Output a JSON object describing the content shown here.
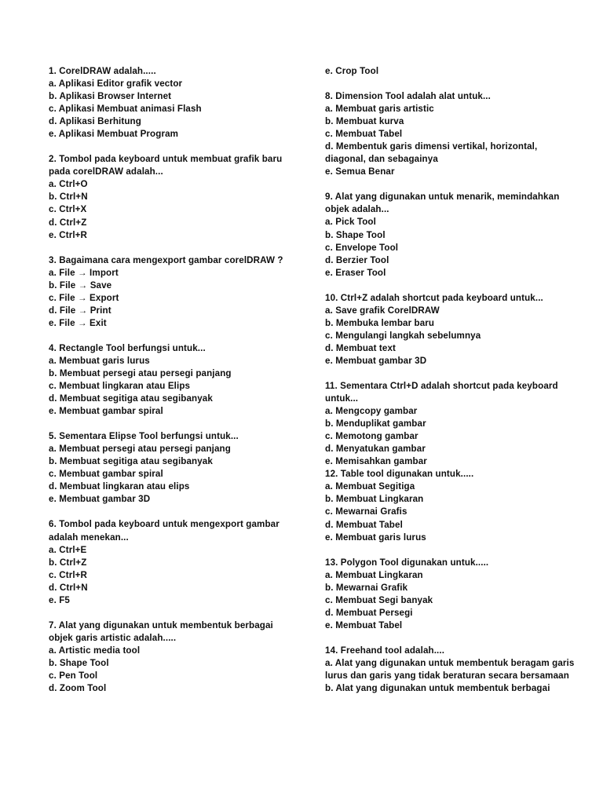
{
  "document": {
    "title": "Soal Pilihan Ganda CorelDRAW",
    "background_color": "#ffffff",
    "text_color": "#0f0f0f"
  },
  "columns": [
    {
      "name": "left-column",
      "blocks": [
        {
          "id": "q1",
          "tight": false,
          "lines": [
            "1. CorelDRAW adalah.....",
            "a. Aplikasi Editor grafik vector",
            "b. Aplikasi Browser Internet",
            "c. Aplikasi Membuat animasi Flash",
            "d. Aplikasi Berhitung",
            "e. Aplikasi Membuat Program"
          ]
        },
        {
          "id": "q2",
          "tight": false,
          "lines": [
            "2. Tombol pada keyboard untuk membuat grafik baru pada corelDRAW adalah...",
            "a. Ctrl+O",
            "b. Ctrl+N",
            "c. Ctrl+X",
            "d. Ctrl+Z",
            "e. Ctrl+R"
          ]
        },
        {
          "id": "q3",
          "tight": false,
          "lines": [
            "3. Bagaimana cara mengexport gambar corelDRAW ?",
            "a. File → Import",
            "b. File → Save",
            "c. File → Export",
            "d. File → Print",
            "e. File → Exit"
          ]
        },
        {
          "id": "q4",
          "tight": false,
          "lines": [
            "4. Rectangle Tool berfungsi untuk...",
            "a. Membuat garis lurus",
            "b. Membuat persegi atau persegi panjang",
            "c. Membuat lingkaran atau Elips",
            "d. Membuat segitiga atau segibanyak",
            "e. Membuat gambar spiral"
          ]
        },
        {
          "id": "q5",
          "tight": false,
          "lines": [
            "5. Sementara Elipse Tool berfungsi untuk...",
            "a. Membuat persegi atau persegi panjang",
            "b. Membuat segitiga atau segibanyak",
            "c. Membuat gambar spiral",
            "d. Membuat lingkaran atau elips",
            "e. Membuat gambar 3D"
          ]
        },
        {
          "id": "q6",
          "tight": false,
          "lines": [
            "6. Tombol pada keyboard untuk mengexport gambar adalah menekan...",
            "a. Ctrl+E",
            "b. Ctrl+Z",
            "c. Ctrl+R",
            "d. Ctrl+N",
            "e. F5"
          ]
        },
        {
          "id": "q7",
          "tight": false,
          "lines": [
            "7. Alat yang digunakan untuk membentuk berbagai objek garis artistic adalah.....",
            "a. Artistic media tool",
            "b. Shape Tool",
            "c. Pen Tool",
            "d. Zoom Tool"
          ]
        }
      ]
    },
    {
      "name": "right-column",
      "blocks": [
        {
          "id": "q7-continued",
          "tight": false,
          "lines": [
            "e. Crop Tool"
          ]
        },
        {
          "id": "q8",
          "tight": false,
          "lines": [
            "8. Dimension Tool adalah alat untuk...",
            "a. Membuat garis artistic",
            "b. Membuat kurva",
            "c. Membuat Tabel",
            "d. Membentuk garis dimensi vertikal, horizontal, diagonal, dan sebagainya",
            "e. Semua Benar"
          ]
        },
        {
          "id": "q9",
          "tight": false,
          "lines": [
            "9. Alat yang digunakan untuk menarik, memindahkan objek adalah...",
            "a. Pick Tool",
            "b. Shape Tool",
            "c. Envelope Tool",
            "d. Berzier Tool",
            "e. Eraser Tool"
          ]
        },
        {
          "id": "q10",
          "tight": false,
          "lines": [
            "10. Ctrl+Z adalah shortcut pada keyboard untuk...",
            "a. Save grafik CorelDRAW",
            "b. Membuka lembar baru",
            "c. Mengulangi langkah sebelumnya",
            "d. Membuat text",
            "e. Membuat gambar 3D"
          ]
        },
        {
          "id": "q11",
          "tight": true,
          "lines": [
            "11. Sementara Ctrl+D adalah shortcut pada keyboard untuk...",
            "a. Mengcopy gambar",
            "b. Menduplikat gambar",
            "c. Memotong gambar",
            "d. Menyatukan gambar",
            "e. Memisahkan gambar"
          ]
        },
        {
          "id": "q12",
          "tight": false,
          "lines": [
            "12. Table tool digunakan untuk.....",
            "a. Membuat Segitiga",
            "b. Membuat Lingkaran",
            "c. Mewarnai Grafis",
            "d. Membuat Tabel",
            "e. Membuat garis lurus"
          ]
        },
        {
          "id": "q13",
          "tight": false,
          "lines": [
            "13. Polygon Tool digunakan untuk.....",
            "a. Membuat Lingkaran",
            "b. Mewarnai Grafik",
            "c. Membuat Segi banyak",
            "d. Membuat Persegi",
            "e. Membuat Tabel"
          ]
        },
        {
          "id": "q14",
          "tight": false,
          "lines": [
            "14. Freehand tool adalah....",
            "a. Alat yang digunakan untuk membentuk beragam garis lurus dan garis yang tidak beraturan secara bersamaan",
            "b. Alat yang digunakan untuk membentuk berbagai"
          ]
        }
      ]
    }
  ]
}
